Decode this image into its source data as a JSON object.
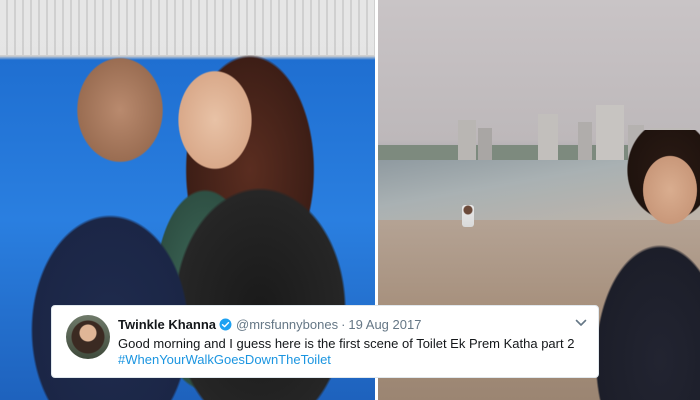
{
  "tweet": {
    "name": "Twinkle Khanna",
    "handle": "@mrsfunnybones",
    "separator": "·",
    "date": "19 Aug 2017",
    "text": "Good morning and I guess here is the first scene of Toilet Ek Prem Katha part 2",
    "hashtag": "#WhenYourWalkGoesDownTheToilet",
    "verified_color": "#1da1f2",
    "hashtag_color": "#1b95e0"
  },
  "icons": {
    "verified": "verified-badge-icon",
    "menu": "chevron-down-icon"
  }
}
